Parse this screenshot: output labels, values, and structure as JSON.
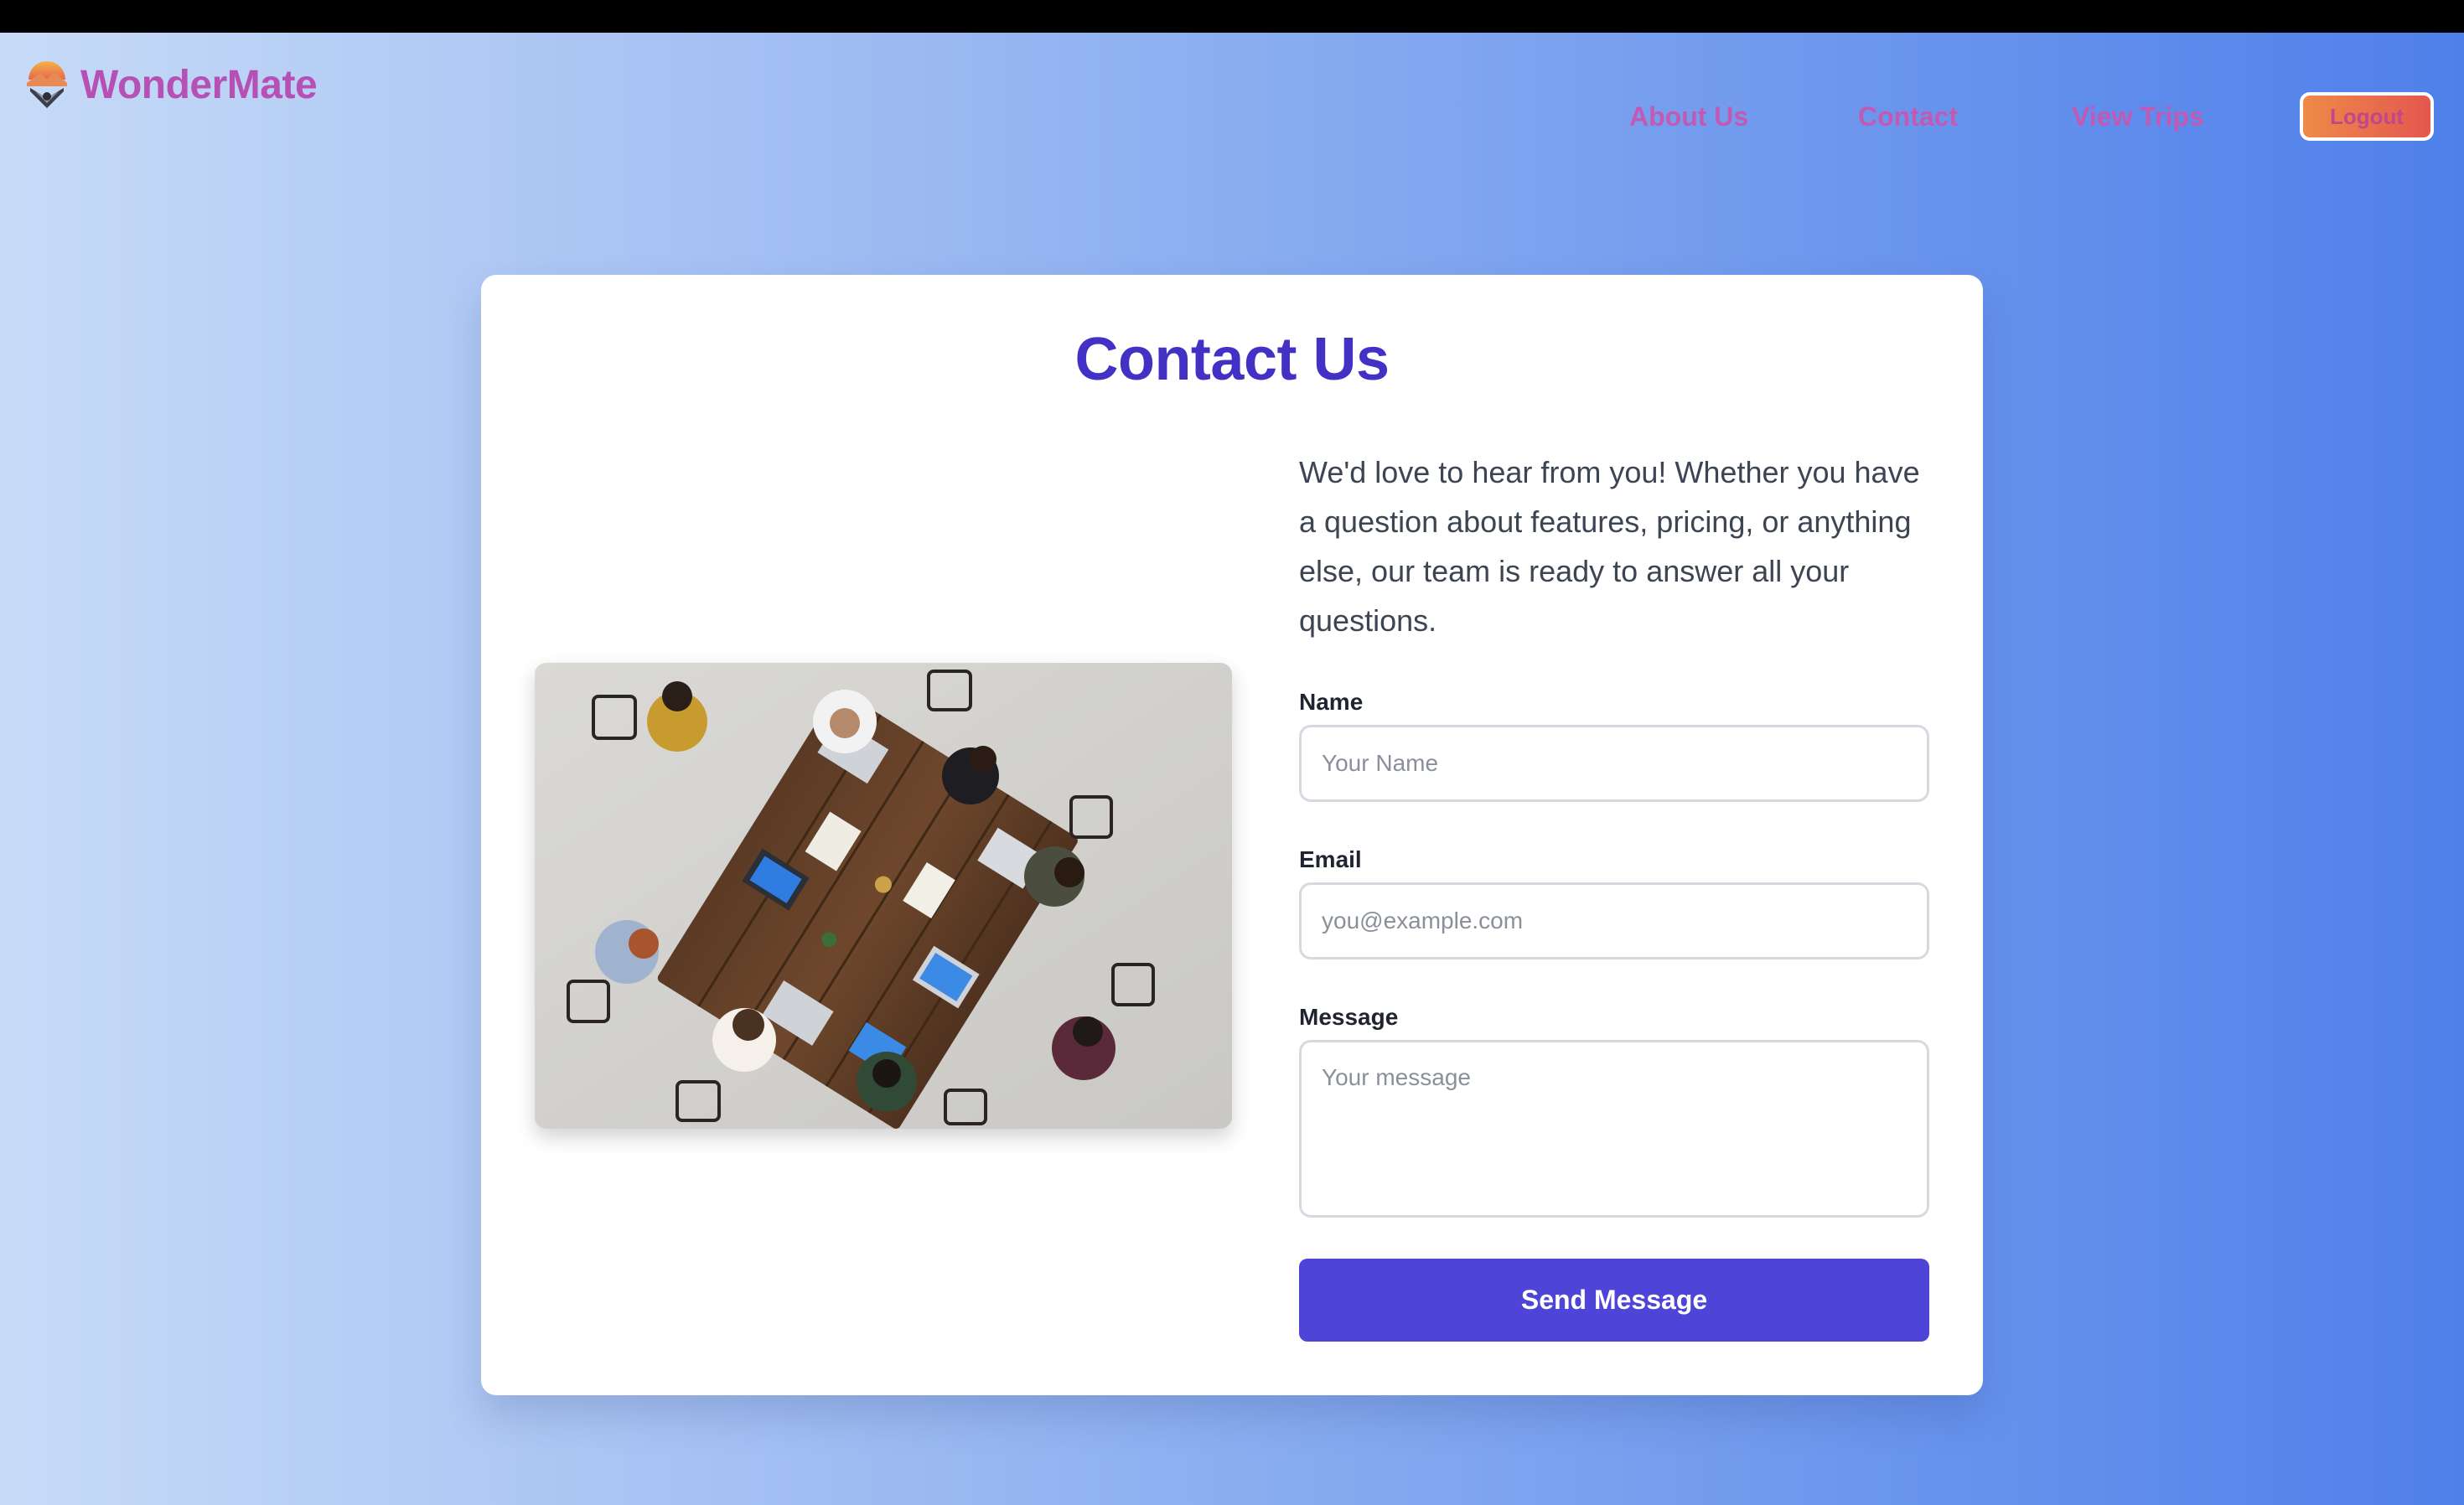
{
  "navbar": {
    "brand": "WonderMate",
    "logo_icon": "mountain-sunset-logo-icon",
    "links": [
      "About Us",
      "Contact",
      "View Trips"
    ],
    "logout_label": "Logout"
  },
  "contact": {
    "title": "Contact Us",
    "intro": "We'd love to hear from you! Whether you have a question about features, pricing, or anything else, our team is ready to answer all your questions.",
    "image_alt": "team-meeting-photo",
    "fields": {
      "name_label": "Name",
      "name_placeholder": "Your Name",
      "email_label": "Email",
      "email_placeholder": "you@example.com",
      "message_label": "Message",
      "message_placeholder": "Your message"
    },
    "submit_label": "Send Message"
  },
  "colors": {
    "accent": "#4e44d8",
    "title": "#4331c6",
    "brand": "#b650b5",
    "nav_link": "#c25ab4",
    "logout_gradient": [
      "#ee8a48",
      "#e4574f"
    ]
  }
}
